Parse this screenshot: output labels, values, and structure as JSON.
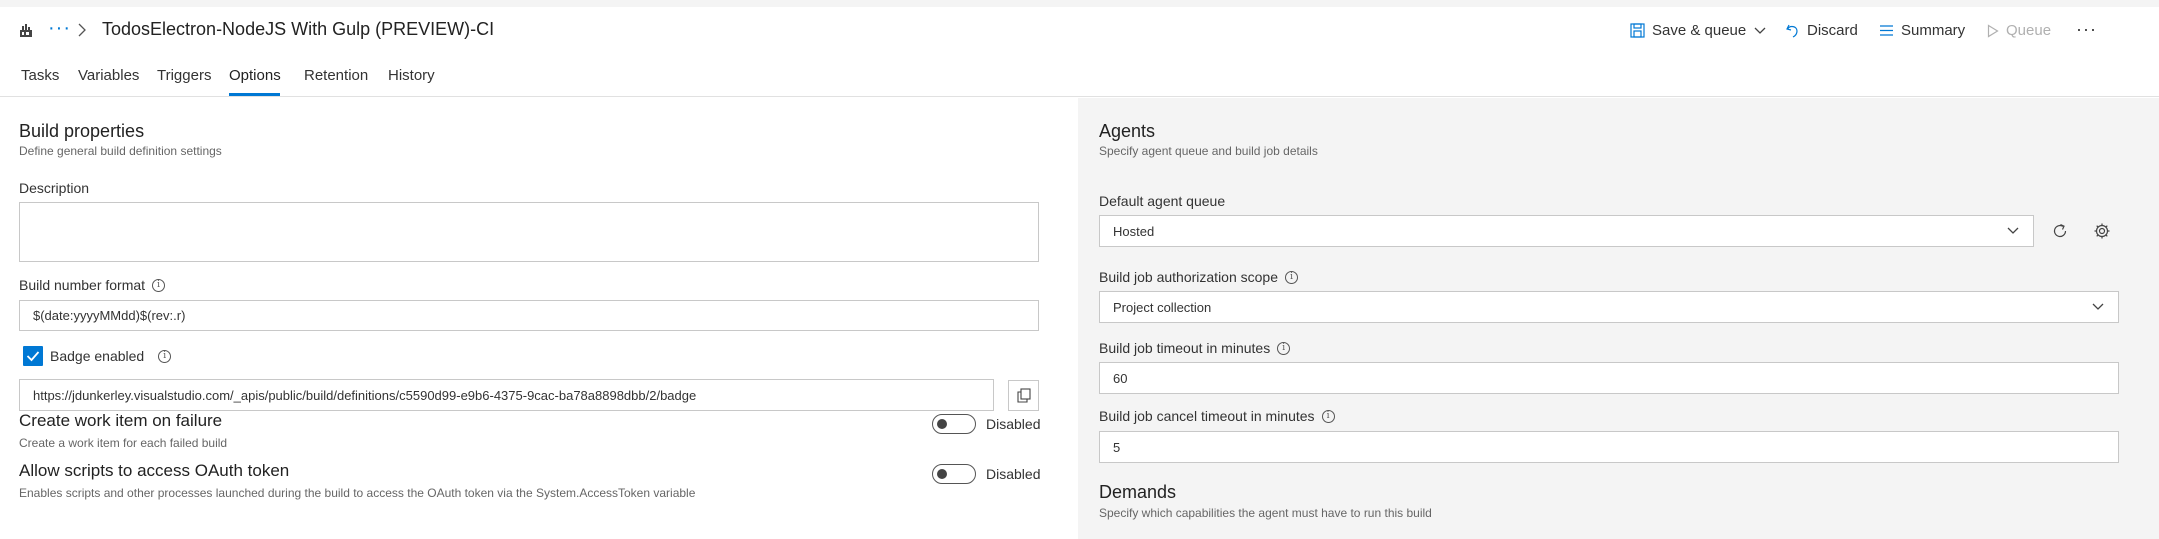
{
  "header": {
    "breadcrumb_more": "···",
    "title": "TodosElectron-NodeJS With Gulp (PREVIEW)-CI",
    "save_queue": "Save & queue",
    "discard": "Discard",
    "summary": "Summary",
    "queue": "Queue",
    "more": "···"
  },
  "tabs": [
    "Tasks",
    "Variables",
    "Triggers",
    "Options",
    "Retention",
    "History"
  ],
  "active_tab": "Options",
  "build_properties": {
    "title": "Build properties",
    "subtitle": "Define general build definition settings",
    "description_label": "Description",
    "description_value": "",
    "build_number_label": "Build number format",
    "build_number_value": "$(date:yyyyMMdd)$(rev:.r)",
    "badge_label": "Badge enabled",
    "badge_checked": true,
    "badge_url": "https://jdunkerley.visualstudio.com/_apis/public/build/definitions/c5590d99-e9b6-4375-9cac-ba78a8898dbb/2/badge",
    "work_item_title": "Create work item on failure",
    "work_item_sub": "Create a work item for each failed build",
    "work_item_state": "Disabled",
    "oauth_title": "Allow scripts to access OAuth token",
    "oauth_sub": "Enables scripts and other processes launched during the build to access the OAuth token via the System.AccessToken variable",
    "oauth_state": "Disabled"
  },
  "agents": {
    "title": "Agents",
    "subtitle": "Specify agent queue and build job details",
    "queue_label": "Default agent queue",
    "queue_value": "Hosted",
    "scope_label": "Build job authorization scope",
    "scope_value": "Project collection",
    "timeout_label": "Build job timeout in minutes",
    "timeout_value": "60",
    "cancel_label": "Build job cancel timeout in minutes",
    "cancel_value": "5"
  },
  "demands": {
    "title": "Demands",
    "subtitle": "Specify which capabilities the agent must have to run this build"
  },
  "colors": {
    "accent": "#0078d4",
    "panel_bg": "#f4f4f4",
    "border": "#c8c8c8"
  }
}
